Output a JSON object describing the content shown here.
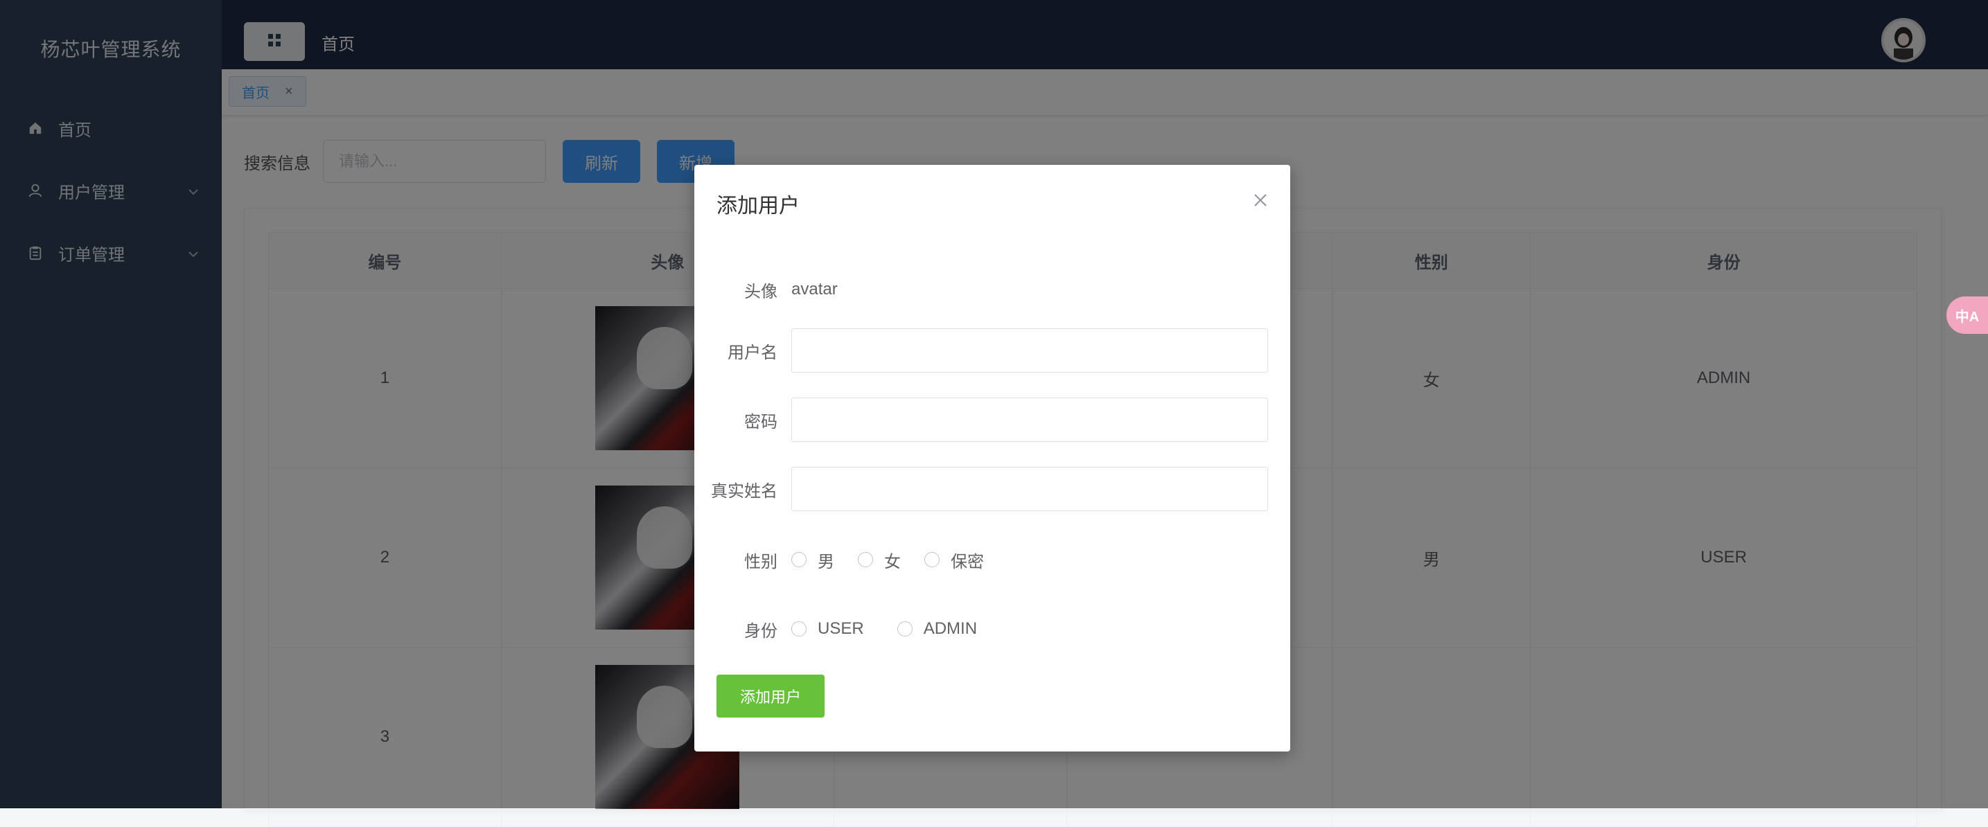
{
  "app": {
    "title": "杨芯叶管理系统"
  },
  "sidebar": {
    "items": [
      {
        "label": "首页",
        "icon": "home-icon",
        "expandable": false
      },
      {
        "label": "用户管理",
        "icon": "user-icon",
        "expandable": true
      },
      {
        "label": "订单管理",
        "icon": "clipboard-icon",
        "expandable": true
      }
    ]
  },
  "header": {
    "title": "首页"
  },
  "tabs": [
    {
      "label": "首页",
      "close": "×"
    }
  ],
  "search": {
    "label": "搜索信息",
    "placeholder": "请输入...",
    "refresh_label": "刷新",
    "add_label": "新增"
  },
  "table": {
    "columns": [
      "编号",
      "头像",
      "",
      "",
      "性别",
      "身份"
    ],
    "rows": [
      {
        "id": "1",
        "gender": "女",
        "role": "ADMIN"
      },
      {
        "id": "2",
        "gender": "男",
        "role": "USER"
      },
      {
        "id": "3",
        "gender": "",
        "role": ""
      }
    ]
  },
  "dialog": {
    "title": "添加用户",
    "fields": {
      "avatar_label": "头像",
      "avatar_value": "avatar",
      "username_label": "用户名",
      "password_label": "密码",
      "realname_label": "真实姓名",
      "gender_label": "性别",
      "gender_options": [
        "男",
        "女",
        "保密"
      ],
      "role_label": "身份",
      "role_options": [
        "USER",
        "ADMIN"
      ]
    },
    "submit_label": "添加用户"
  },
  "translate_fab": {
    "label": "中A"
  },
  "colors": {
    "sidebar": "#304156",
    "header": "#1f2a44",
    "primary": "#409eff",
    "success": "#67c23a"
  }
}
